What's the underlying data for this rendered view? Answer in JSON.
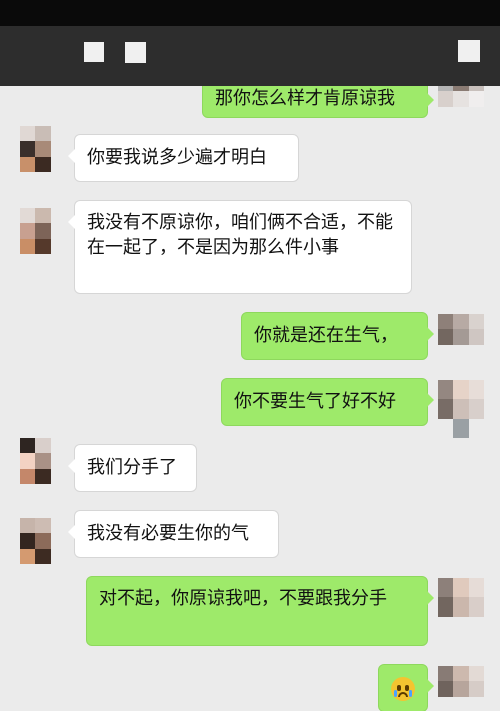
{
  "messages": [
    {
      "side": "right",
      "text": "那你怎么样才肯原谅我"
    },
    {
      "side": "left",
      "text": "你要我说多少遍才明白"
    },
    {
      "side": "left",
      "text": "我没有不原谅你，咱们俩不合适，不能在一起了，不是因为那么件小事"
    },
    {
      "side": "right",
      "text": "你就是还在生气，"
    },
    {
      "side": "right",
      "text": "你不要生气了好不好"
    },
    {
      "side": "left",
      "text": "我们分手了"
    },
    {
      "side": "left",
      "text": "我没有必要生你的气"
    },
    {
      "side": "right",
      "text": "对不起，你原谅我吧，不要跟我分手"
    },
    {
      "side": "right",
      "emoji": "crying-face"
    }
  ],
  "colors": {
    "background": "#ebebeb",
    "topbar": "#2d2d2d",
    "bubble_left": "#ffffff",
    "bubble_right": "#9eea6a"
  }
}
